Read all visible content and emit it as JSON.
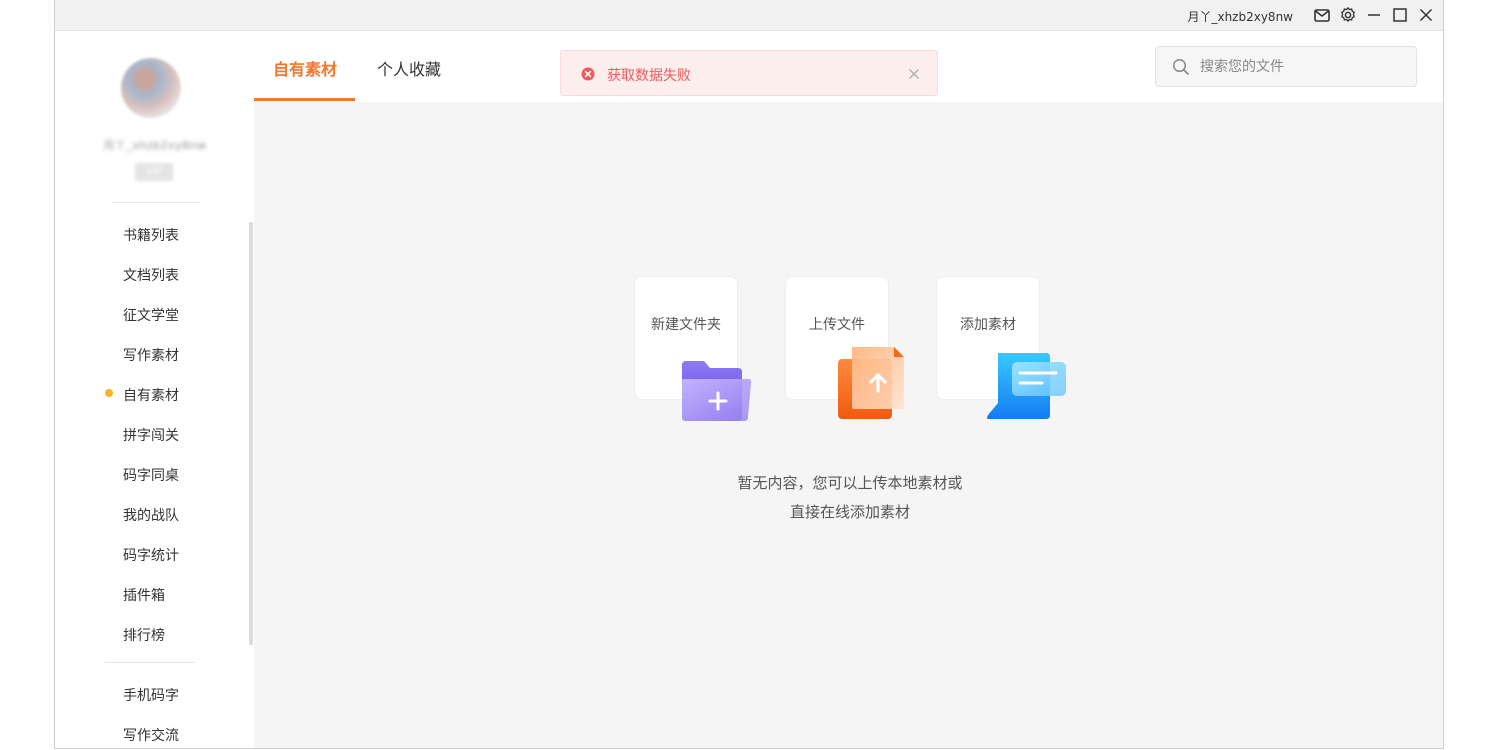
{
  "titlebar": {
    "username": "月丫_xhzb2xy8nw",
    "icons": [
      "mail-icon",
      "gear-icon",
      "minimize-icon",
      "maximize-icon",
      "close-icon"
    ]
  },
  "sidebar": {
    "username_blurred": "月丫_xhzb2xy8nw",
    "vip_badge": "VIP",
    "nav": [
      {
        "label": "书籍列表",
        "active": false
      },
      {
        "label": "文档列表",
        "active": false
      },
      {
        "label": "征文学堂",
        "active": false
      },
      {
        "label": "写作素材",
        "active": false
      },
      {
        "label": "自有素材",
        "active": true
      },
      {
        "label": "拼字闯关",
        "active": false
      },
      {
        "label": "码字同桌",
        "active": false
      },
      {
        "label": "我的战队",
        "active": false
      },
      {
        "label": "码字统计",
        "active": false
      },
      {
        "label": "插件箱",
        "active": false
      },
      {
        "label": "排行榜",
        "active": false
      }
    ],
    "nav_bottom": [
      {
        "label": "手机码字"
      },
      {
        "label": "写作交流"
      }
    ]
  },
  "tabs": [
    {
      "label": "自有素材",
      "active": true
    },
    {
      "label": "个人收藏",
      "active": false
    }
  ],
  "toast": {
    "message": "获取数据失败",
    "type": "error"
  },
  "search": {
    "placeholder": "搜索您的文件",
    "value": ""
  },
  "actions": [
    {
      "label": "新建文件夹",
      "icon": "folder-add-icon"
    },
    {
      "label": "上传文件",
      "icon": "upload-file-icon"
    },
    {
      "label": "添加素材",
      "icon": "add-material-icon"
    }
  ],
  "empty_state": {
    "line1": "暂无内容，您可以上传本地素材或",
    "line2": "直接在线添加素材"
  },
  "colors": {
    "accent": "#f4762c",
    "active_dot": "#f5b325",
    "error_text": "#f05a5a",
    "error_bg": "#fdeeee"
  }
}
